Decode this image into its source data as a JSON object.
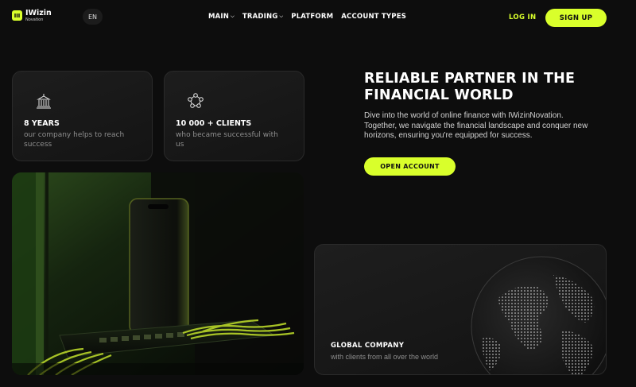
{
  "brand": {
    "name": "IWizin",
    "sub": "Novation",
    "accent": "#d9ff2b"
  },
  "header": {
    "language": "EN",
    "nav": [
      {
        "label": "MAIN",
        "has_dropdown": true
      },
      {
        "label": "TRADING",
        "has_dropdown": true
      },
      {
        "label": "PLATFORM",
        "has_dropdown": false
      },
      {
        "label": "ACCOUNT TYPES",
        "has_dropdown": false
      }
    ],
    "login_label": "LOG IN",
    "signup_label": "SIGN UP"
  },
  "stats": [
    {
      "icon": "bank-building-icon",
      "title": "8 YEARS",
      "desc": "our company helps to reach success"
    },
    {
      "icon": "clients-network-icon",
      "title": "10 000 + CLIENTS",
      "desc": "who became successful with us"
    }
  ],
  "hero": {
    "title": "RELIABLE PARTNER IN THE FINANCIAL WORLD",
    "description": "Dive into the world of online finance with IWizinNovation. Together, we navigate the financial landscape and conquer new horizons, ensuring you're equipped for success.",
    "cta_label": "OPEN ACCOUNT"
  },
  "global": {
    "title": "GLOBAL COMPANY",
    "desc": "with clients from all over the world",
    "icon": "globe-icon"
  },
  "image": {
    "icon": "phone-server-image"
  }
}
